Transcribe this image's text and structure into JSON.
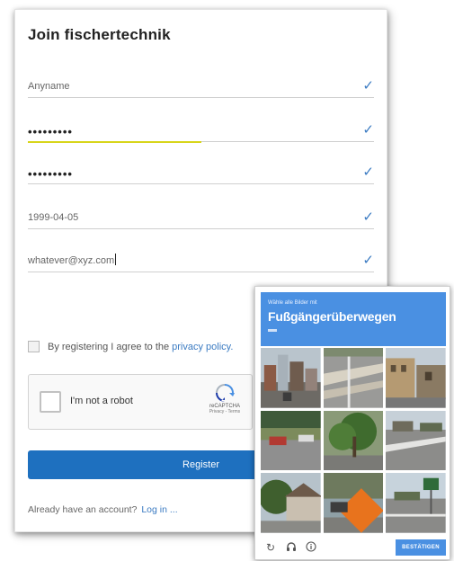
{
  "form": {
    "title": "Join fischertechnik",
    "fields": [
      {
        "value": "Anyname",
        "type": "text"
      },
      {
        "value": "•••••••••",
        "type": "password"
      },
      {
        "value": "•••••••••",
        "type": "password"
      },
      {
        "value": "1999-04-05",
        "type": "text"
      },
      {
        "value": "whatever@xyz.com",
        "type": "text"
      }
    ],
    "agree_text": "By registering I agree to the",
    "agree_link": "privacy policy.",
    "captcha_label": "I'm not a robot",
    "captcha_brand": "reCAPTCHA",
    "captcha_sub": "Privacy - Terms",
    "register_label": "Register",
    "login_text": "Already have an account?",
    "login_link": "Log in ...",
    "password_strength": 0.5
  },
  "challenge": {
    "instruction": "Wähle alle Bilder mit",
    "target": "Fußgängerüberwegen",
    "verify_label": "BESTÄTIGEN",
    "tiles": [
      "city-buildings",
      "crosswalk-lot",
      "building-street",
      "street-car",
      "tree-road",
      "intersection",
      "house-tree",
      "stop-sign",
      "road-signs"
    ]
  },
  "icons": {
    "check": "check-icon",
    "reload": "reload-icon",
    "audio": "headphones-icon",
    "info": "info-icon"
  }
}
